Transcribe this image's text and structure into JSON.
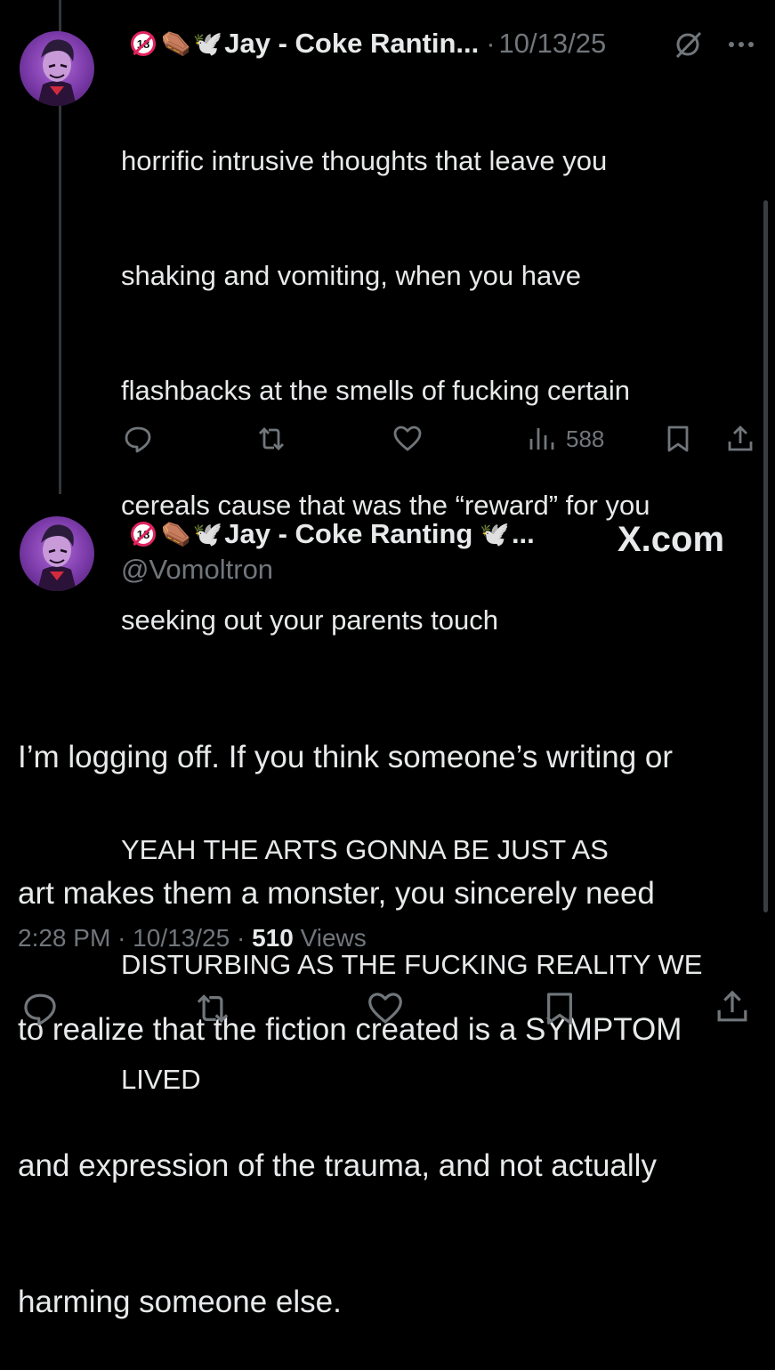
{
  "tweet1": {
    "name": "Jay - Coke Rantin...",
    "separator": "·",
    "date": "10/13/25",
    "body_lines": [
      "horrific intrusive thoughts that leave you",
      "shaking and vomiting, when you have",
      "flashbacks at the smells of fucking certain",
      "cereals cause that was the “reward” for you",
      "seeking out your parents touch",
      "",
      "YEAH THE ARTS GONNA BE JUST AS",
      "DISTURBING AS THE FUCKING REALITY WE",
      "LIVED"
    ],
    "views": "588"
  },
  "tweet2": {
    "name": "Jay - Coke Ranting",
    "name_suffix": "...",
    "handle": "@Vomoltron",
    "watermark": "X.com",
    "body_lines": [
      "I’m logging off. If you think someone’s writing or",
      "art makes them a monster, you sincerely need",
      "to realize that the fiction created is a SYMPTOM",
      "and expression of the trauma, and not actually",
      "harming someone else."
    ],
    "time": "2:28 PM",
    "date": "10/13/25",
    "separator": "·",
    "views_count": "510",
    "views_label": "Views"
  },
  "icons": {
    "badge": "no-under-18-icon",
    "coffin": "coffin-emoji",
    "dove": "dove-emoji",
    "grok": "grok-icon",
    "more": "more-icon",
    "reply": "reply-icon",
    "retweet": "retweet-icon",
    "like": "like-icon",
    "views": "views-icon",
    "bookmark": "bookmark-icon",
    "share": "share-icon"
  },
  "colors": {
    "background": "#000000",
    "text": "#e7e9ea",
    "muted": "#71767b",
    "badge_red": "#e0245e"
  }
}
